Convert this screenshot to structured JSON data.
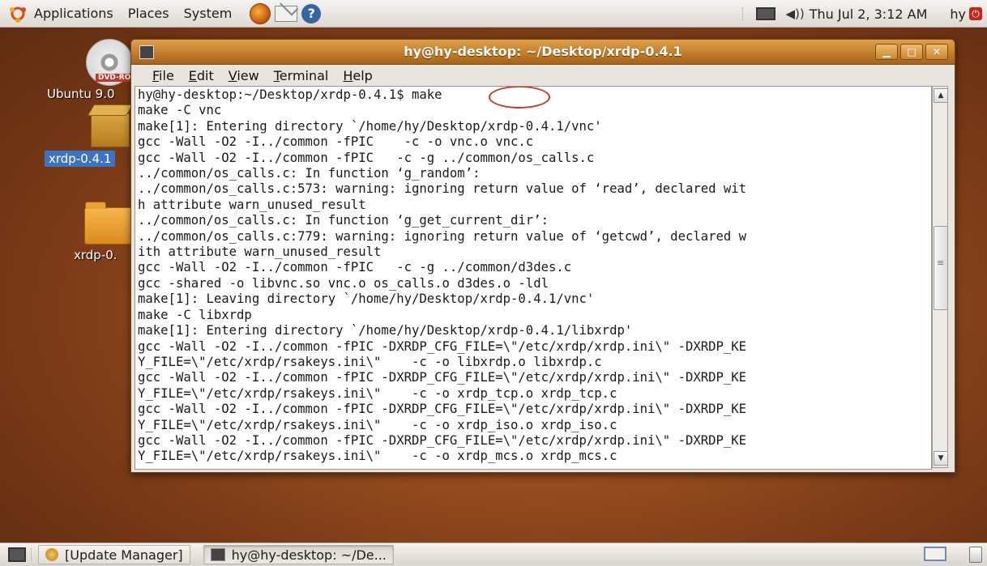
{
  "top_panel": {
    "menus": [
      "Applications",
      "Places",
      "System"
    ],
    "clock": "Thu Jul  2,  3:12 AM",
    "user": "hy",
    "icons": [
      "ubuntu-logo",
      "firefox-icon",
      "mail-icon",
      "help-icon",
      "network-icon",
      "volume-icon",
      "power-icon"
    ]
  },
  "desktop": {
    "dvd_label": "DVD-ROM",
    "dvd_name": "Ubuntu 9.0",
    "folder1_name": "xrdp-0.4.1",
    "folder2_name": "xrdp-0."
  },
  "terminal": {
    "title": "hy@hy-desktop: ~/Desktop/xrdp-0.4.1",
    "menu": [
      "File",
      "Edit",
      "View",
      "Terminal",
      "Help"
    ],
    "window_buttons": [
      "minimize",
      "maximize",
      "close"
    ],
    "prompt": "hy@hy-desktop:~/Desktop/xrdp-0.4.1$ ",
    "command": "make",
    "output_lines": [
      "make -C vnc",
      "make[1]: Entering directory `/home/hy/Desktop/xrdp-0.4.1/vnc'",
      "gcc -Wall -O2 -I../common -fPIC    -c -o vnc.o vnc.c",
      "gcc -Wall -O2 -I../common -fPIC   -c -g ../common/os_calls.c",
      "../common/os_calls.c: In function ‘g_random’:",
      "../common/os_calls.c:573: warning: ignoring return value of ‘read’, declared wit",
      "h attribute warn_unused_result",
      "../common/os_calls.c: In function ‘g_get_current_dir’:",
      "../common/os_calls.c:779: warning: ignoring return value of ‘getcwd’, declared w",
      "ith attribute warn_unused_result",
      "gcc -Wall -O2 -I../common -fPIC   -c -g ../common/d3des.c",
      "gcc -shared -o libvnc.so vnc.o os_calls.o d3des.o -ldl",
      "make[1]: Leaving directory `/home/hy/Desktop/xrdp-0.4.1/vnc'",
      "make -C libxrdp",
      "make[1]: Entering directory `/home/hy/Desktop/xrdp-0.4.1/libxrdp'",
      "gcc -Wall -O2 -I../common -fPIC -DXRDP_CFG_FILE=\\\"/etc/xrdp/xrdp.ini\\\" -DXRDP_KE",
      "Y_FILE=\\\"/etc/xrdp/rsakeys.ini\\\"    -c -o libxrdp.o libxrdp.c",
      "gcc -Wall -O2 -I../common -fPIC -DXRDP_CFG_FILE=\\\"/etc/xrdp/xrdp.ini\\\" -DXRDP_KE",
      "Y_FILE=\\\"/etc/xrdp/rsakeys.ini\\\"    -c -o xrdp_tcp.o xrdp_tcp.c",
      "gcc -Wall -O2 -I../common -fPIC -DXRDP_CFG_FILE=\\\"/etc/xrdp/xrdp.ini\\\" -DXRDP_KE",
      "Y_FILE=\\\"/etc/xrdp/rsakeys.ini\\\"    -c -o xrdp_iso.o xrdp_iso.c",
      "gcc -Wall -O2 -I../common -fPIC -DXRDP_CFG_FILE=\\\"/etc/xrdp/xrdp.ini\\\" -DXRDP_KE",
      "Y_FILE=\\\"/etc/xrdp/rsakeys.ini\\\"    -c -o xrdp_mcs.o xrdp_mcs.c"
    ]
  },
  "bottom_panel": {
    "tasks": [
      "[Update Manager]",
      "hy@hy-desktop: ~/De..."
    ]
  }
}
